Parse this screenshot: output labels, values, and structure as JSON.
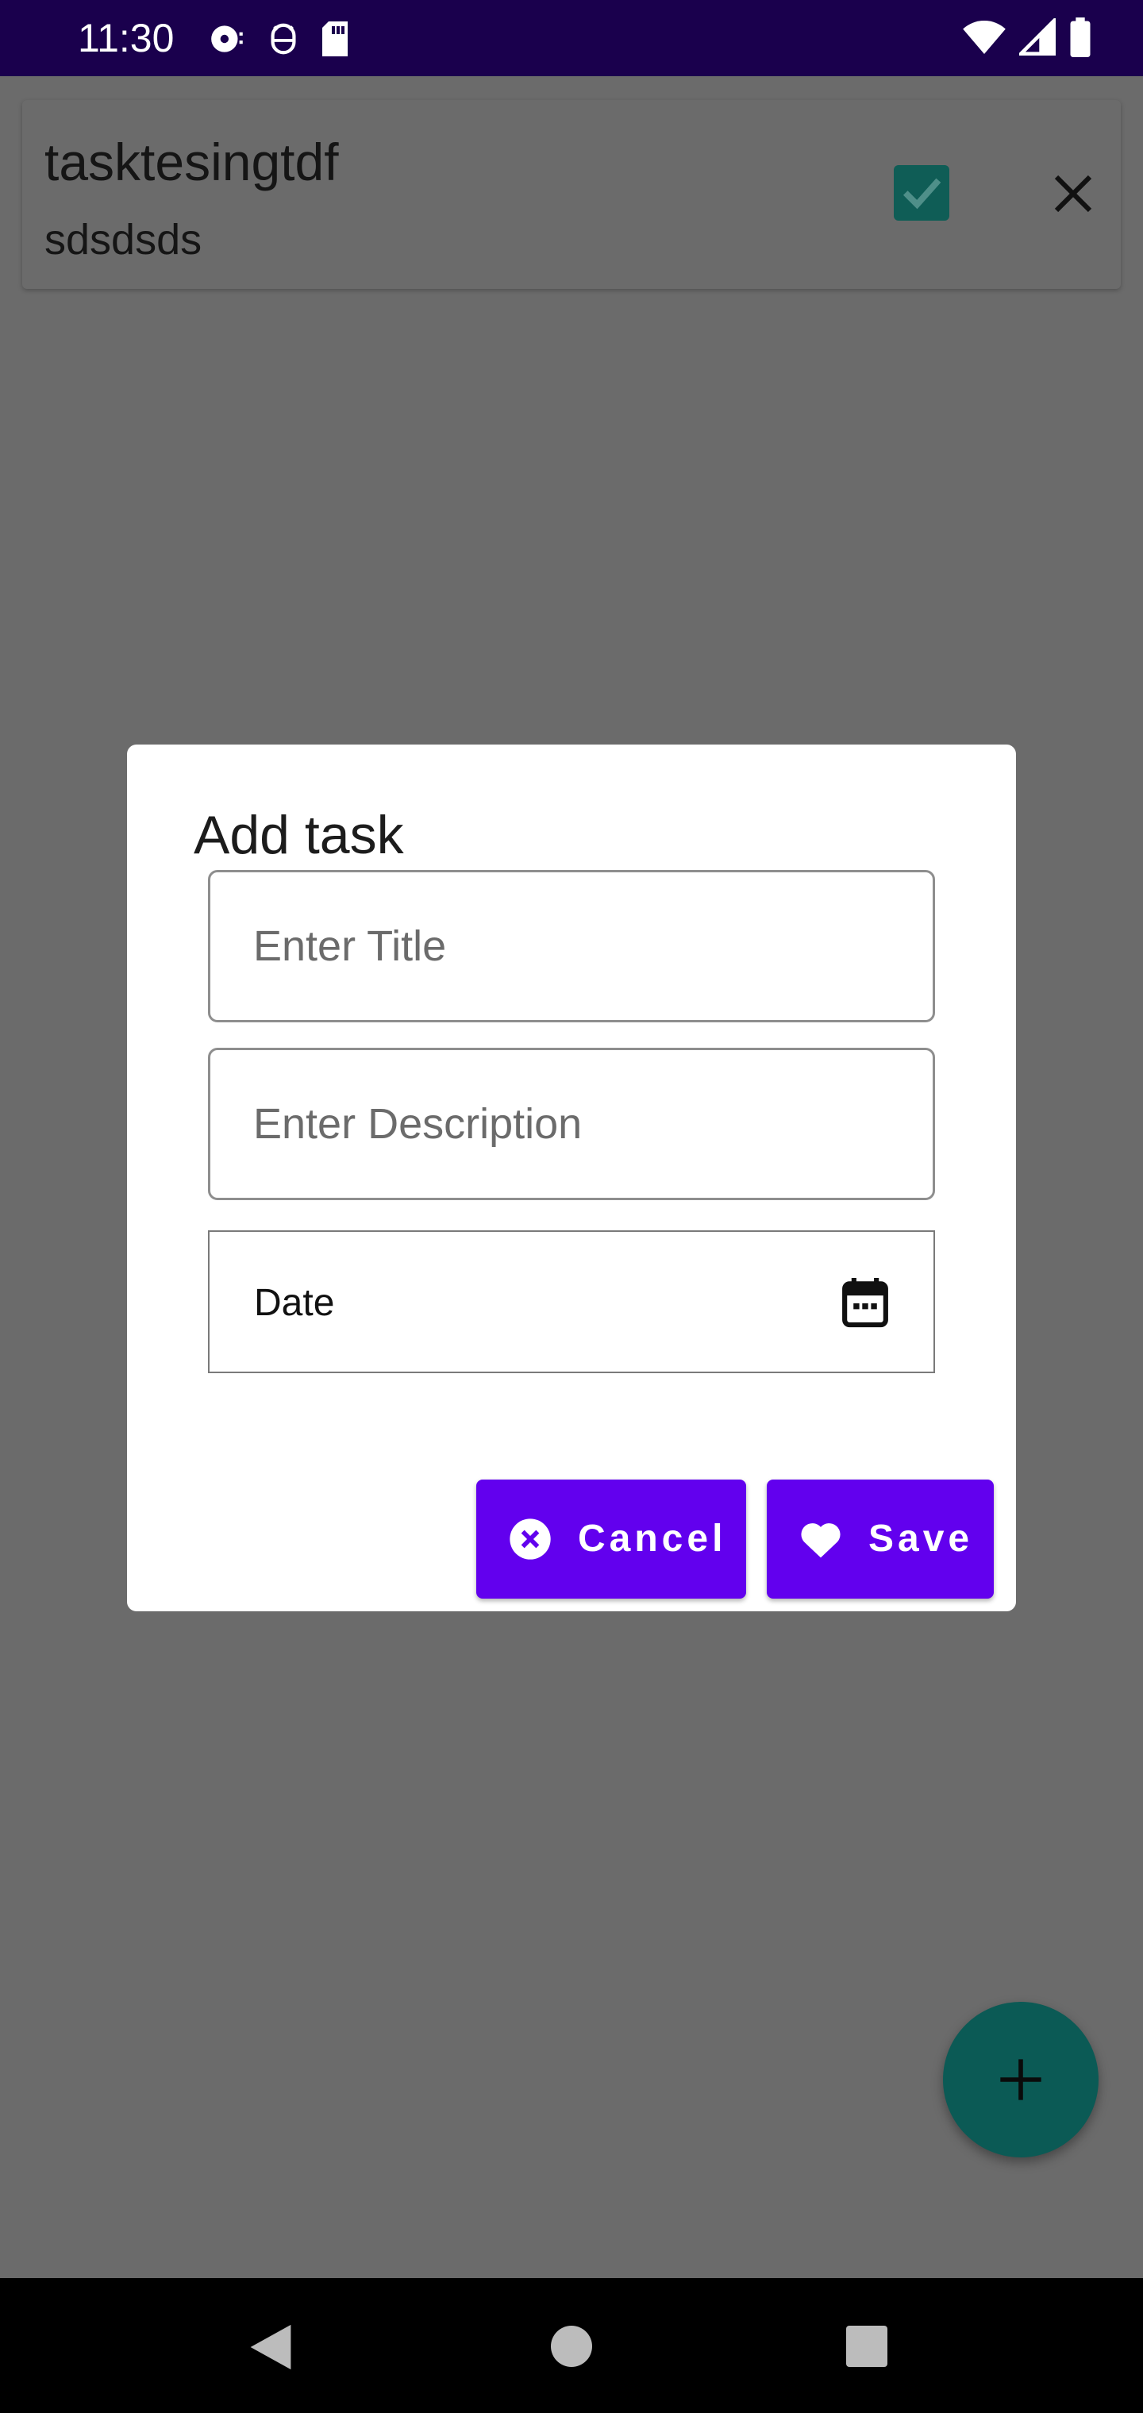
{
  "status_bar": {
    "time": "11:30",
    "left_icons": [
      "media-notification-icon",
      "usb-debug-icon",
      "sd-card-icon"
    ],
    "right_icons": [
      "wifi-icon",
      "cell-signal-icon",
      "battery-icon"
    ],
    "background_color": "#1a004d"
  },
  "task_list": {
    "items": [
      {
        "title": "tasktesingtdf",
        "description": "sdsdsds",
        "completed": true
      }
    ]
  },
  "fab": {
    "icon": "plus-icon",
    "color": "#0b5a55"
  },
  "dialog": {
    "title": "Add task",
    "title_field": {
      "placeholder": "Enter Title",
      "value": ""
    },
    "description_field": {
      "placeholder": "Enter Description",
      "value": ""
    },
    "date_field": {
      "label": "Date",
      "icon": "calendar-icon"
    },
    "cancel_button": {
      "label": "Cancel",
      "icon": "cancel-circle-icon"
    },
    "save_button": {
      "label": "Save",
      "icon": "heart-icon"
    },
    "accent_color": "#6200ee"
  },
  "nav_bar": {
    "buttons": [
      "back",
      "home",
      "recents"
    ]
  }
}
